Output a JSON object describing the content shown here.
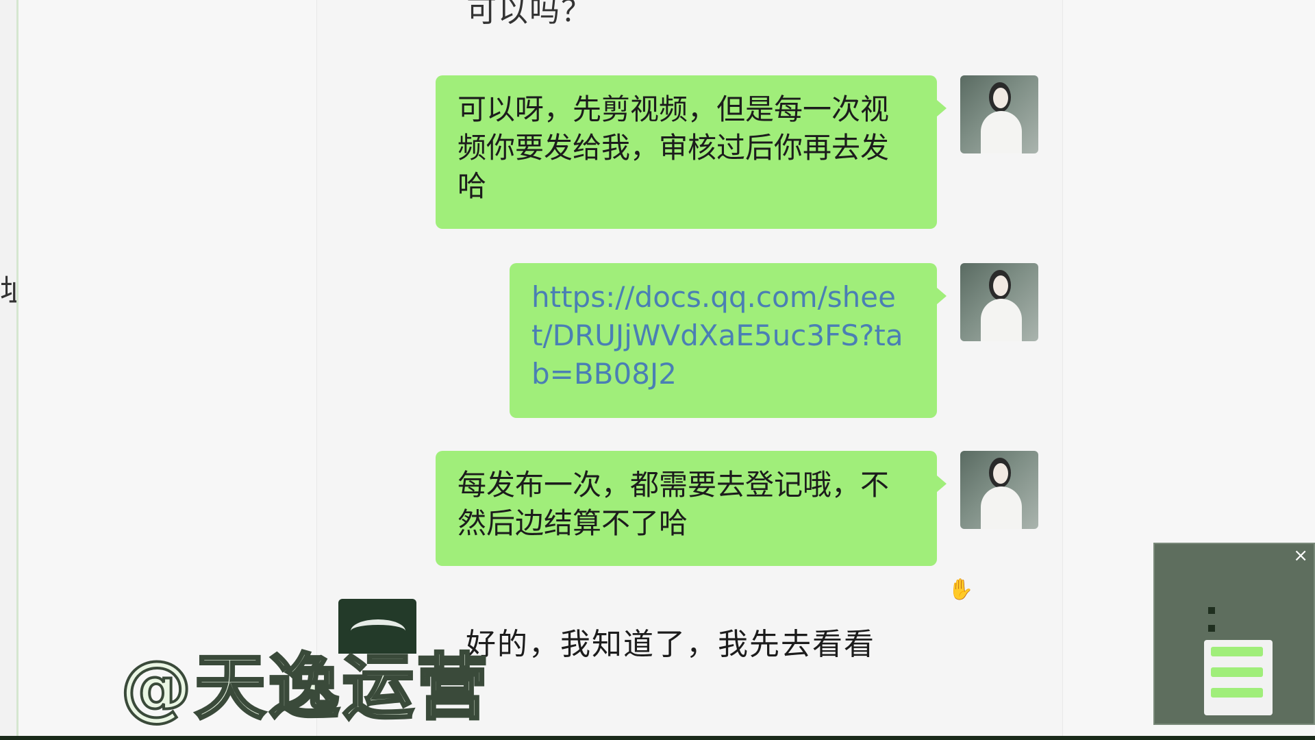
{
  "chat": {
    "partial_top_text": "可以吗？",
    "messages": [
      {
        "text": "可以呀，先剪视频，但是每一次视频你要发给我，审核过后你再去发哈"
      },
      {
        "text": "https://docs.qq.com/sheet/DRUJjWVdXaE5uc3FS?tab=BB08J2"
      },
      {
        "text": "每发布一次，都需要去登记哦，不然后边结算不了哈"
      }
    ],
    "incoming_partial_text": "好的，我知道了，我先去看看"
  },
  "left_edge_text": "址",
  "watermark": "@天逸运营",
  "thumbnail_window": {
    "close_icon": "×"
  },
  "colors": {
    "bubble_green": "#a0ee7a",
    "link_blue": "#4a7fb4"
  }
}
